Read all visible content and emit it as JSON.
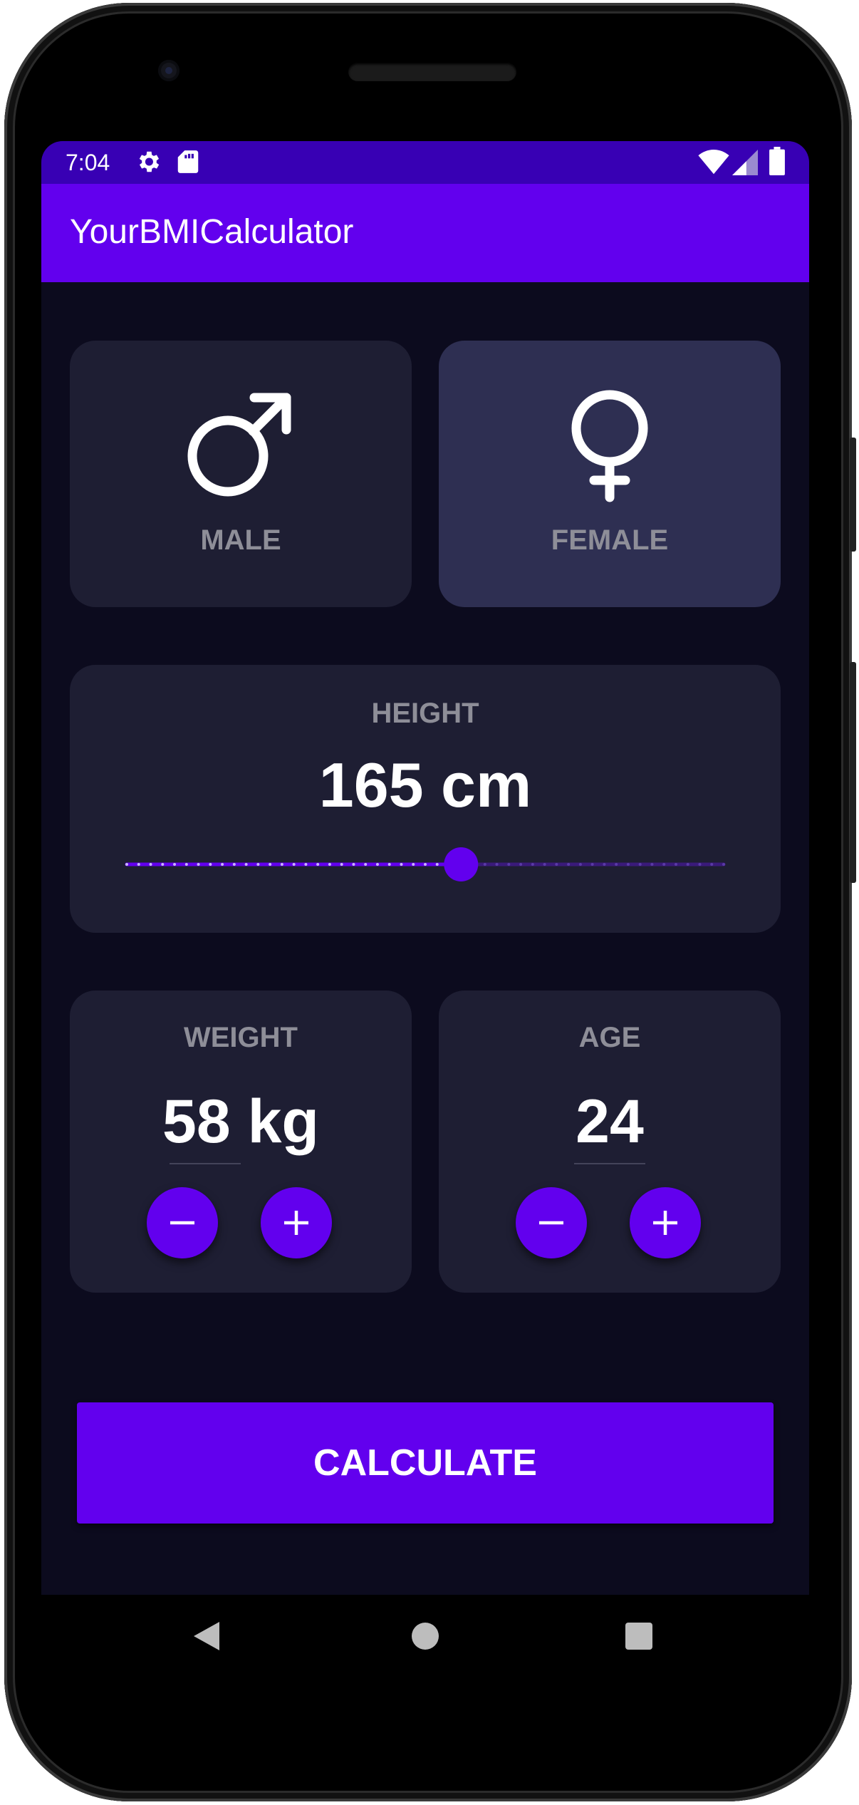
{
  "status_bar": {
    "time": "7:04",
    "icons": [
      "settings-icon",
      "sd-card-icon",
      "wifi-icon",
      "cell-signal-icon",
      "battery-icon"
    ]
  },
  "app_bar": {
    "title": "YourBMICalculator"
  },
  "gender": {
    "male": {
      "label": "MALE",
      "icon": "male-symbol-icon",
      "selected": false
    },
    "female": {
      "label": "FEMALE",
      "icon": "female-symbol-icon",
      "selected": true
    }
  },
  "height": {
    "label": "HEIGHT",
    "value_text": "165 cm",
    "slider_fraction": 0.56
  },
  "weight": {
    "label": "WEIGHT",
    "value": "58",
    "unit": "kg"
  },
  "age": {
    "label": "AGE",
    "value": "24"
  },
  "calculate_label": "CALCULATE",
  "colors": {
    "accent": "#6200ee",
    "status_bar": "#3800b4",
    "background": "#0c0b1e",
    "card": "#1e1e33",
    "card_selected": "#2e2f52"
  },
  "nav_icons": [
    "back-icon",
    "home-icon",
    "recents-icon"
  ]
}
